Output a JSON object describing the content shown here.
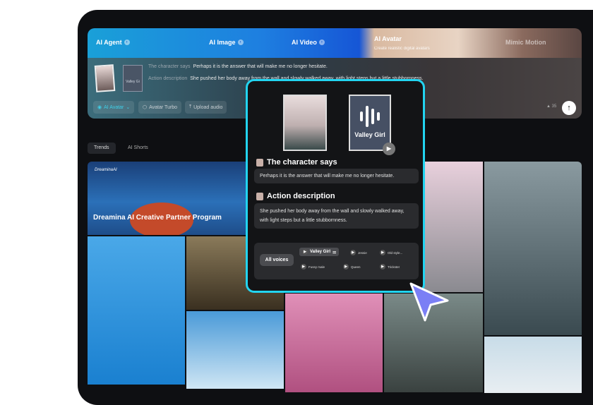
{
  "banner": {
    "items": [
      {
        "label": "AI Agent"
      },
      {
        "label": "AI Image"
      },
      {
        "label": "AI Video"
      },
      {
        "label": "AI Avatar",
        "subtitle": "Create realistic digital avatars"
      },
      {
        "label": "Mimic Motion"
      }
    ]
  },
  "prompt": {
    "audio_name": "Valley Gi",
    "character_says_label": "The character says",
    "character_says": "Perhaps it is the answer that will make me no longer hesitate.",
    "action_label": "Action description",
    "action": "She pushed her body away from the wall and slowly walked away, with light steps but a little stubbornness.",
    "action_visible_end": "stubbornness.",
    "mode": "AI Avatar",
    "model": "Avatar Turbo",
    "upload": "Upload audio",
    "count": "35"
  },
  "tabs": [
    "Trends",
    "AI Shorts"
  ],
  "gallery": {
    "brand": "DreaminaAI",
    "feature_title": "Dreamina AI Creative Partner Program"
  },
  "popup": {
    "audio_name": "Valley Girl",
    "character_says_label": "The character says",
    "character_says": "Perhaps it is the answer that will make me no longer hesitate.",
    "action_label": "Action description",
    "action": "She pushed her body away from the wall and slowly walked away, with light steps but a little stubbornness.",
    "all_voices": "All voices",
    "voices": [
      "Valley Girl",
      "Jessie",
      "Old style...",
      "Fussy male",
      "Queen",
      "Trickster"
    ]
  },
  "colors": {
    "accent": "#22d4f0",
    "cursor": "#7b7ff5"
  }
}
